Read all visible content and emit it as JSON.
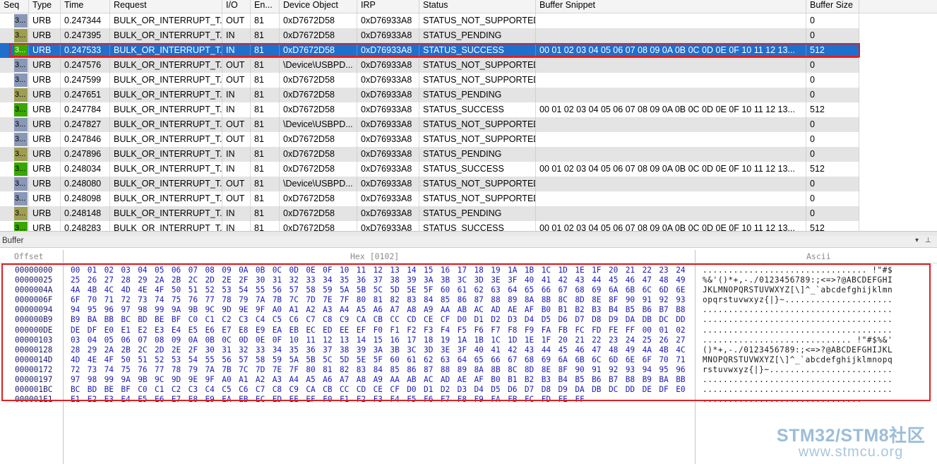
{
  "grid": {
    "columns": [
      "Seq",
      "Type",
      "Time",
      "Request",
      "I/O",
      "En...",
      "Device Object",
      "IRP",
      "Status",
      "Buffer Snippet",
      "Buffer Size"
    ],
    "rows": [
      {
        "seq": "3...",
        "type": "URB",
        "time": "0.247344",
        "request": "BULK_OR_INTERRUPT_T...",
        "io": "OUT",
        "endpoint": "81",
        "device": "0xD7672D58",
        "irp": "0xD76933A8",
        "status": "STATUS_NOT_SUPPORTED",
        "snippet": "",
        "size": "0"
      },
      {
        "seq": "3...",
        "type": "URB",
        "time": "0.247395",
        "request": "BULK_OR_INTERRUPT_T...",
        "io": "IN",
        "endpoint": "81",
        "device": "0xD7672D58",
        "irp": "0xD76933A8",
        "status": "STATUS_PENDING",
        "snippet": "",
        "size": "0"
      },
      {
        "seq": "3...",
        "type": "URB",
        "time": "0.247533",
        "request": "BULK_OR_INTERRUPT_T...",
        "io": "IN",
        "endpoint": "81",
        "device": "0xD7672D58",
        "irp": "0xD76933A8",
        "status": "STATUS_SUCCESS",
        "snippet": "00 01 02 03 04 05 06 07 08 09 0A 0B 0C 0D 0E 0F 10 11 12 13...",
        "size": "512"
      },
      {
        "seq": "3...",
        "type": "URB",
        "time": "0.247576",
        "request": "BULK_OR_INTERRUPT_T...",
        "io": "OUT",
        "endpoint": "81",
        "device": "\\Device\\USBPD...",
        "irp": "0xD76933A8",
        "status": "STATUS_NOT_SUPPORTED",
        "snippet": "",
        "size": "0"
      },
      {
        "seq": "3...",
        "type": "URB",
        "time": "0.247599",
        "request": "BULK_OR_INTERRUPT_T...",
        "io": "OUT",
        "endpoint": "81",
        "device": "0xD7672D58",
        "irp": "0xD76933A8",
        "status": "STATUS_NOT_SUPPORTED",
        "snippet": "",
        "size": "0"
      },
      {
        "seq": "3...",
        "type": "URB",
        "time": "0.247651",
        "request": "BULK_OR_INTERRUPT_T...",
        "io": "IN",
        "endpoint": "81",
        "device": "0xD7672D58",
        "irp": "0xD76933A8",
        "status": "STATUS_PENDING",
        "snippet": "",
        "size": "0"
      },
      {
        "seq": "3...",
        "type": "URB",
        "time": "0.247784",
        "request": "BULK_OR_INTERRUPT_T...",
        "io": "IN",
        "endpoint": "81",
        "device": "0xD7672D58",
        "irp": "0xD76933A8",
        "status": "STATUS_SUCCESS",
        "snippet": "00 01 02 03 04 05 06 07 08 09 0A 0B 0C 0D 0E 0F 10 11 12 13...",
        "size": "512"
      },
      {
        "seq": "3...",
        "type": "URB",
        "time": "0.247827",
        "request": "BULK_OR_INTERRUPT_T...",
        "io": "OUT",
        "endpoint": "81",
        "device": "\\Device\\USBPD...",
        "irp": "0xD76933A8",
        "status": "STATUS_NOT_SUPPORTED",
        "snippet": "",
        "size": "0"
      },
      {
        "seq": "3...",
        "type": "URB",
        "time": "0.247846",
        "request": "BULK_OR_INTERRUPT_T...",
        "io": "OUT",
        "endpoint": "81",
        "device": "0xD7672D58",
        "irp": "0xD76933A8",
        "status": "STATUS_NOT_SUPPORTED",
        "snippet": "",
        "size": "0"
      },
      {
        "seq": "3...",
        "type": "URB",
        "time": "0.247896",
        "request": "BULK_OR_INTERRUPT_T...",
        "io": "IN",
        "endpoint": "81",
        "device": "0xD7672D58",
        "irp": "0xD76933A8",
        "status": "STATUS_PENDING",
        "snippet": "",
        "size": "0"
      },
      {
        "seq": "3...",
        "type": "URB",
        "time": "0.248034",
        "request": "BULK_OR_INTERRUPT_T...",
        "io": "IN",
        "endpoint": "81",
        "device": "0xD7672D58",
        "irp": "0xD76933A8",
        "status": "STATUS_SUCCESS",
        "snippet": "00 01 02 03 04 05 06 07 08 09 0A 0B 0C 0D 0E 0F 10 11 12 13...",
        "size": "512"
      },
      {
        "seq": "3...",
        "type": "URB",
        "time": "0.248080",
        "request": "BULK_OR_INTERRUPT_T...",
        "io": "OUT",
        "endpoint": "81",
        "device": "\\Device\\USBPD...",
        "irp": "0xD76933A8",
        "status": "STATUS_NOT_SUPPORTED",
        "snippet": "",
        "size": "0"
      },
      {
        "seq": "3...",
        "type": "URB",
        "time": "0.248098",
        "request": "BULK_OR_INTERRUPT_T...",
        "io": "OUT",
        "endpoint": "81",
        "device": "0xD7672D58",
        "irp": "0xD76933A8",
        "status": "STATUS_NOT_SUPPORTED",
        "snippet": "",
        "size": "0"
      },
      {
        "seq": "3...",
        "type": "URB",
        "time": "0.248148",
        "request": "BULK_OR_INTERRUPT_T...",
        "io": "IN",
        "endpoint": "81",
        "device": "0xD7672D58",
        "irp": "0xD76933A8",
        "status": "STATUS_PENDING",
        "snippet": "",
        "size": "0"
      },
      {
        "seq": "3...",
        "type": "URB",
        "time": "0.248283",
        "request": "BULK_OR_INTERRUPT_T...",
        "io": "IN",
        "endpoint": "81",
        "device": "0xD7672D58",
        "irp": "0xD76933A8",
        "status": "STATUS_SUCCESS",
        "snippet": "00 01 02 03 04 05 06 07 08 09 0A 0B 0C 0D 0E 0F 10 11 12 13...",
        "size": "512"
      }
    ],
    "selected_row": 2
  },
  "buffer_panel": {
    "title": "Buffer",
    "pin_icon": "pin-icon",
    "dropdown_icon": "dropdown-icon",
    "offset_header": "Offset",
    "hex_header": "Hex [0102]",
    "ascii_header": "Ascii",
    "offsets": [
      "00000000",
      "00000025",
      "0000004A",
      "0000006F",
      "00000094",
      "000000B9",
      "000000DE",
      "00000103",
      "00000128",
      "0000014D",
      "00000172",
      "00000197",
      "000001BC",
      "000001E1"
    ],
    "hex_rows": [
      "00 01 02 03 04 05 06 07 08 09 0A 0B 0C 0D 0E 0F 10 11 12 13 14 15 16 17 18 19 1A 1B 1C 1D 1E 1F 20 21 22 23 24",
      "25 26 27 28 29 2A 2B 2C 2D 2E 2F 30 31 32 33 34 35 36 37 38 39 3A 3B 3C 3D 3E 3F 40 41 42 43 44 45 46 47 48 49",
      "4A 4B 4C 4D 4E 4F 50 51 52 53 54 55 56 57 58 59 5A 5B 5C 5D 5E 5F 60 61 62 63 64 65 66 67 68 69 6A 6B 6C 6D 6E",
      "6F 70 71 72 73 74 75 76 77 78 79 7A 7B 7C 7D 7E 7F 80 81 82 83 84 85 86 87 88 89 8A 8B 8C 8D 8E 8F 90 91 92 93",
      "94 95 96 97 98 99 9A 9B 9C 9D 9E 9F A0 A1 A2 A3 A4 A5 A6 A7 A8 A9 AA AB AC AD AE AF B0 B1 B2 B3 B4 B5 B6 B7 B8",
      "B9 BA BB BC BD BE BF C0 C1 C2 C3 C4 C5 C6 C7 C8 C9 CA CB CC CD CE CF D0 D1 D2 D3 D4 D5 D6 D7 D8 D9 DA DB DC DD",
      "DE DF E0 E1 E2 E3 E4 E5 E6 E7 E8 E9 EA EB EC ED EE EF F0 F1 F2 F3 F4 F5 F6 F7 F8 F9 FA FB FC FD FE FF 00 01 02",
      "03 04 05 06 07 08 09 0A 0B 0C 0D 0E 0F 10 11 12 13 14 15 16 17 18 19 1A 1B 1C 1D 1E 1F 20 21 22 23 24 25 26 27",
      "28 29 2A 2B 2C 2D 2E 2F 30 31 32 33 34 35 36 37 38 39 3A 3B 3C 3D 3E 3F 40 41 42 43 44 45 46 47 48 49 4A 4B 4C",
      "4D 4E 4F 50 51 52 53 54 55 56 57 58 59 5A 5B 5C 5D 5E 5F 60 61 62 63 64 65 66 67 68 69 6A 6B 6C 6D 6E 6F 70 71",
      "72 73 74 75 76 77 78 79 7A 7B 7C 7D 7E 7F 80 81 82 83 84 85 86 87 88 89 8A 8B 8C 8D 8E 8F 90 91 92 93 94 95 96",
      "97 98 99 9A 9B 9C 9D 9E 9F A0 A1 A2 A3 A4 A5 A6 A7 A8 A9 AA AB AC AD AE AF B0 B1 B2 B3 B4 B5 B6 B7 B8 B9 BA BB",
      "BC BD BE BF C0 C1 C2 C3 C4 C5 C6 C7 C8 C9 CA CB CC CD CE CF D0 D1 D2 D3 D4 D5 D6 D7 D8 D9 DA DB DC DD DE DF E0",
      "E1 E2 E3 E4 E5 E6 E7 E8 E9 EA EB EC ED EE EF F0 F1 F2 F3 F4 F5 F6 F7 F8 F9 FA FB FC FD FE FF"
    ],
    "ascii_rows": [
      "................................ !\"#$",
      "%&'()*+,-./0123456789:;<=>?@ABCDEFGHI",
      "JKLMNOPQRSTUVWXYZ[\\]^_`abcdefghijklmn",
      "opqrstuvwxyz{|}~.....................",
      ".....................................",
      ".....................................",
      ".....................................",
      "............................. !\"#$%&'",
      "()*+,-./0123456789:;<=>?@ABCDEFGHIJKL",
      "MNOPQRSTUVWXYZ[\\]^_`abcdefghijklmnopq",
      "rstuvwxyz{|}~........................",
      ".....................................",
      ".....................................",
      "..............................."
    ]
  },
  "watermark": {
    "line1": "STM32/STM8社区",
    "line2": "www.stmcu.org"
  }
}
